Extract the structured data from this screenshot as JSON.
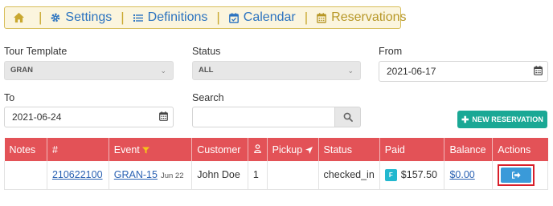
{
  "nav": {
    "items": [
      {
        "label": "Settings"
      },
      {
        "label": "Definitions"
      },
      {
        "label": "Calendar"
      },
      {
        "label": "Reservations"
      }
    ],
    "separator": "|"
  },
  "filters": {
    "tour_template": {
      "label": "Tour Template",
      "value": "GRAN"
    },
    "status": {
      "label": "Status",
      "value": "ALL"
    },
    "from": {
      "label": "From",
      "value": "2021-06-17"
    },
    "to": {
      "label": "To",
      "value": "2021-06-24"
    },
    "search": {
      "label": "Search",
      "value": ""
    }
  },
  "new_reservation_label": "NEW RESERVATION",
  "table": {
    "headers": {
      "notes": "Notes",
      "number": "#",
      "event": "Event",
      "customer": "Customer",
      "pickup": "Pickup",
      "status": "Status",
      "paid": "Paid",
      "balance": "Balance",
      "actions": "Actions"
    },
    "rows": [
      {
        "notes": "",
        "number": "210622100",
        "event": "GRAN-15",
        "event_date": "Jun 22",
        "customer": "John Doe",
        "guests": "1",
        "pickup": "",
        "status": "checked_in",
        "paid_badge": "F",
        "paid": "$157.50",
        "balance": "$0.00"
      }
    ]
  },
  "colors": {
    "header_bg": "#e35257",
    "nav_bg": "#fbf5de",
    "link": "#2b62b3",
    "new_button": "#1aa895",
    "action_button": "#3a9ad9",
    "highlight_border": "#d81f2a"
  },
  "icons": [
    "home-icon",
    "gear-icon",
    "list-icon",
    "calendar-check-icon",
    "calendar-icon",
    "chevron-down-icon",
    "search-icon",
    "filter-icon",
    "user-icon",
    "location-arrow-icon",
    "sign-out-icon"
  ]
}
